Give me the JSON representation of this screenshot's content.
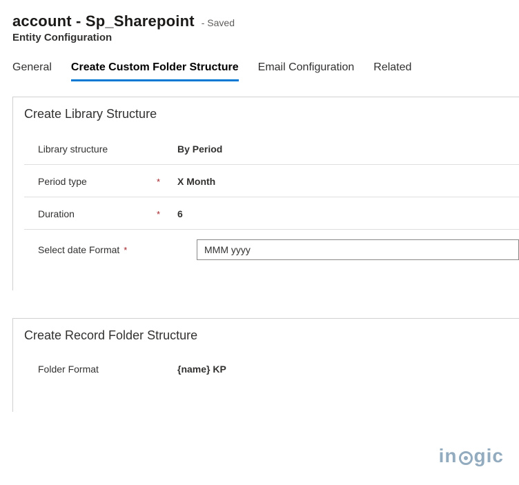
{
  "header": {
    "title": "account - Sp_Sharepoint",
    "status": "- Saved",
    "subtitle": "Entity Configuration"
  },
  "tabs": [
    {
      "label": "General",
      "active": false
    },
    {
      "label": "Create Custom Folder Structure",
      "active": true
    },
    {
      "label": "Email Configuration",
      "active": false
    },
    {
      "label": "Related",
      "active": false
    }
  ],
  "section_library": {
    "title": "Create Library Structure",
    "fields": {
      "library_structure": {
        "label": "Library structure",
        "value": "By Period",
        "required": false
      },
      "period_type": {
        "label": "Period type",
        "value": "X Month",
        "required": true
      },
      "duration": {
        "label": "Duration",
        "value": "6",
        "required": true
      },
      "date_format": {
        "label": "Select date Format",
        "value": "MMM yyyy",
        "required": true
      }
    }
  },
  "section_record": {
    "title": "Create Record Folder Structure",
    "fields": {
      "folder_format": {
        "label": "Folder Format",
        "value": "{name} KP",
        "required": false
      }
    }
  },
  "watermark": {
    "pre": "in",
    "post": "gic"
  }
}
